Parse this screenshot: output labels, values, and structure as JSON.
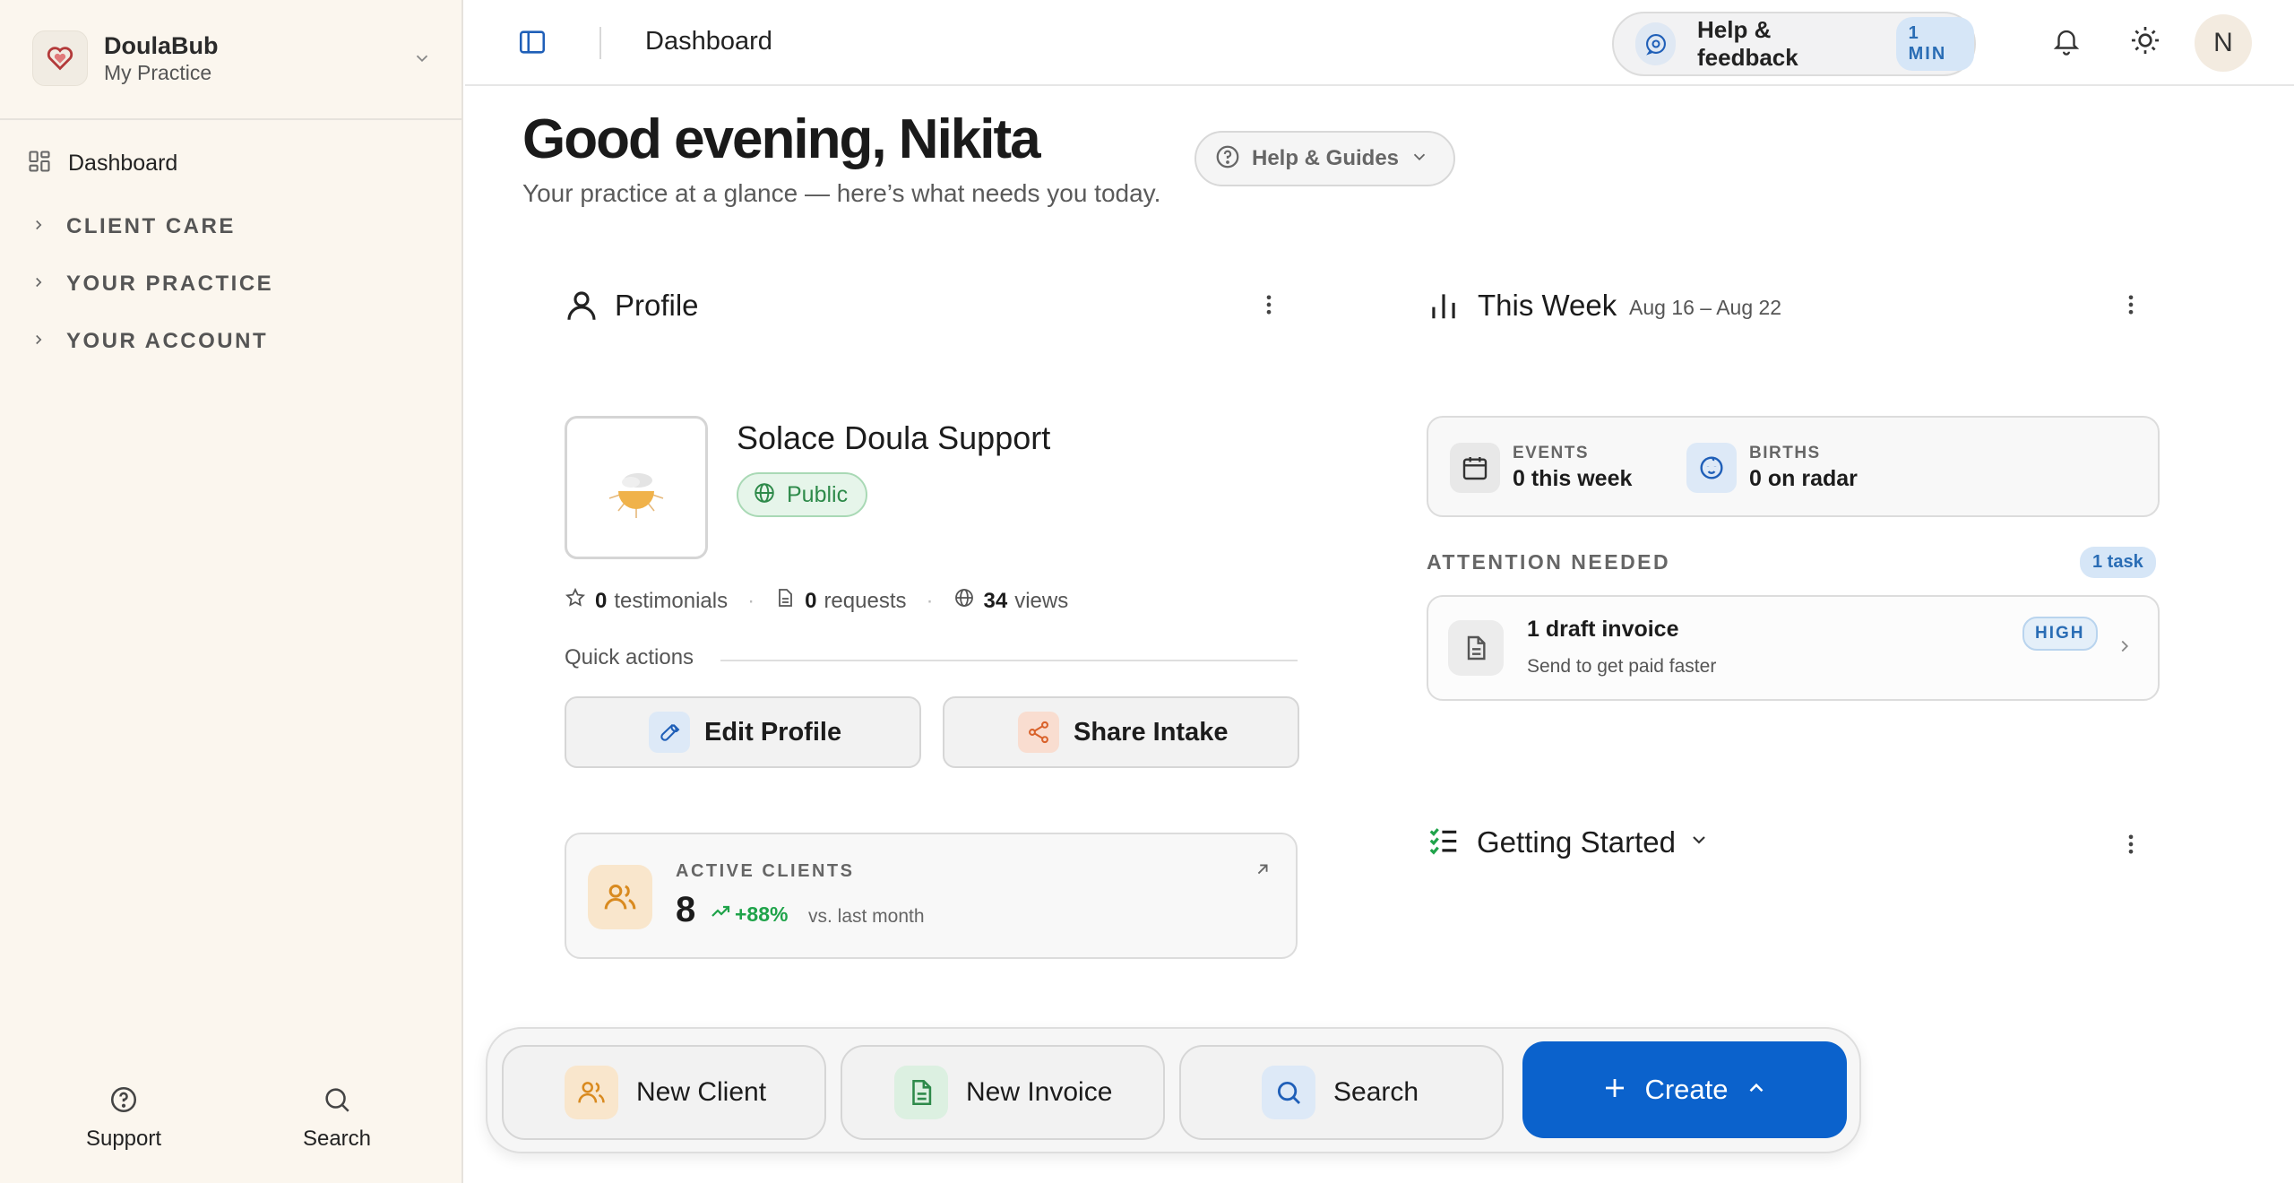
{
  "sidebar": {
    "brand_name": "DoulaBub",
    "brand_sub": "My Practice",
    "dashboard_label": "Dashboard",
    "sections": [
      "CLIENT CARE",
      "YOUR PRACTICE",
      "YOUR ACCOUNT"
    ],
    "support_label": "Support",
    "search_label": "Search"
  },
  "topbar": {
    "title": "Dashboard",
    "help_label": "Help & feedback",
    "help_badge": "1 MIN",
    "avatar_initial": "N"
  },
  "greeting": {
    "title": "Good evening, Nikita",
    "subtitle": "Your practice at a glance — here’s what needs you today.",
    "guides_label": "Help & Guides"
  },
  "profile": {
    "card_title": "Profile",
    "name": "Solace Doula Support",
    "visibility": "Public",
    "stats": [
      {
        "value": "0",
        "label": "testimonials"
      },
      {
        "value": "0",
        "label": "requests"
      },
      {
        "value": "34",
        "label": "views"
      }
    ],
    "quick_actions_label": "Quick actions",
    "edit_label": "Edit Profile",
    "share_label": "Share Intake",
    "active_clients_label": "ACTIVE CLIENTS",
    "active_clients_value": "8",
    "active_clients_trend": "+88%",
    "active_clients_vs": "vs. last month"
  },
  "this_week": {
    "title": "This Week",
    "range": "Aug 16 – Aug 22",
    "events_label": "EVENTS",
    "events_value": "0 this week",
    "births_label": "BIRTHS",
    "births_value": "0 on radar",
    "attention_label": "ATTENTION NEEDED",
    "task_badge": "1 task",
    "task_title": "1 draft invoice",
    "task_sub": "Send to get paid faster",
    "priority": "HIGH"
  },
  "getting_started": {
    "title": "Getting Started"
  },
  "dock": {
    "new_client": "New Client",
    "new_invoice": "New Invoice",
    "search": "Search",
    "create": "Create"
  },
  "colors": {
    "accent": "#0b62cc",
    "sidebar_bg": "#fbf6ee",
    "success": "#1fa34a",
    "badge_blue": "#2a6db5"
  }
}
